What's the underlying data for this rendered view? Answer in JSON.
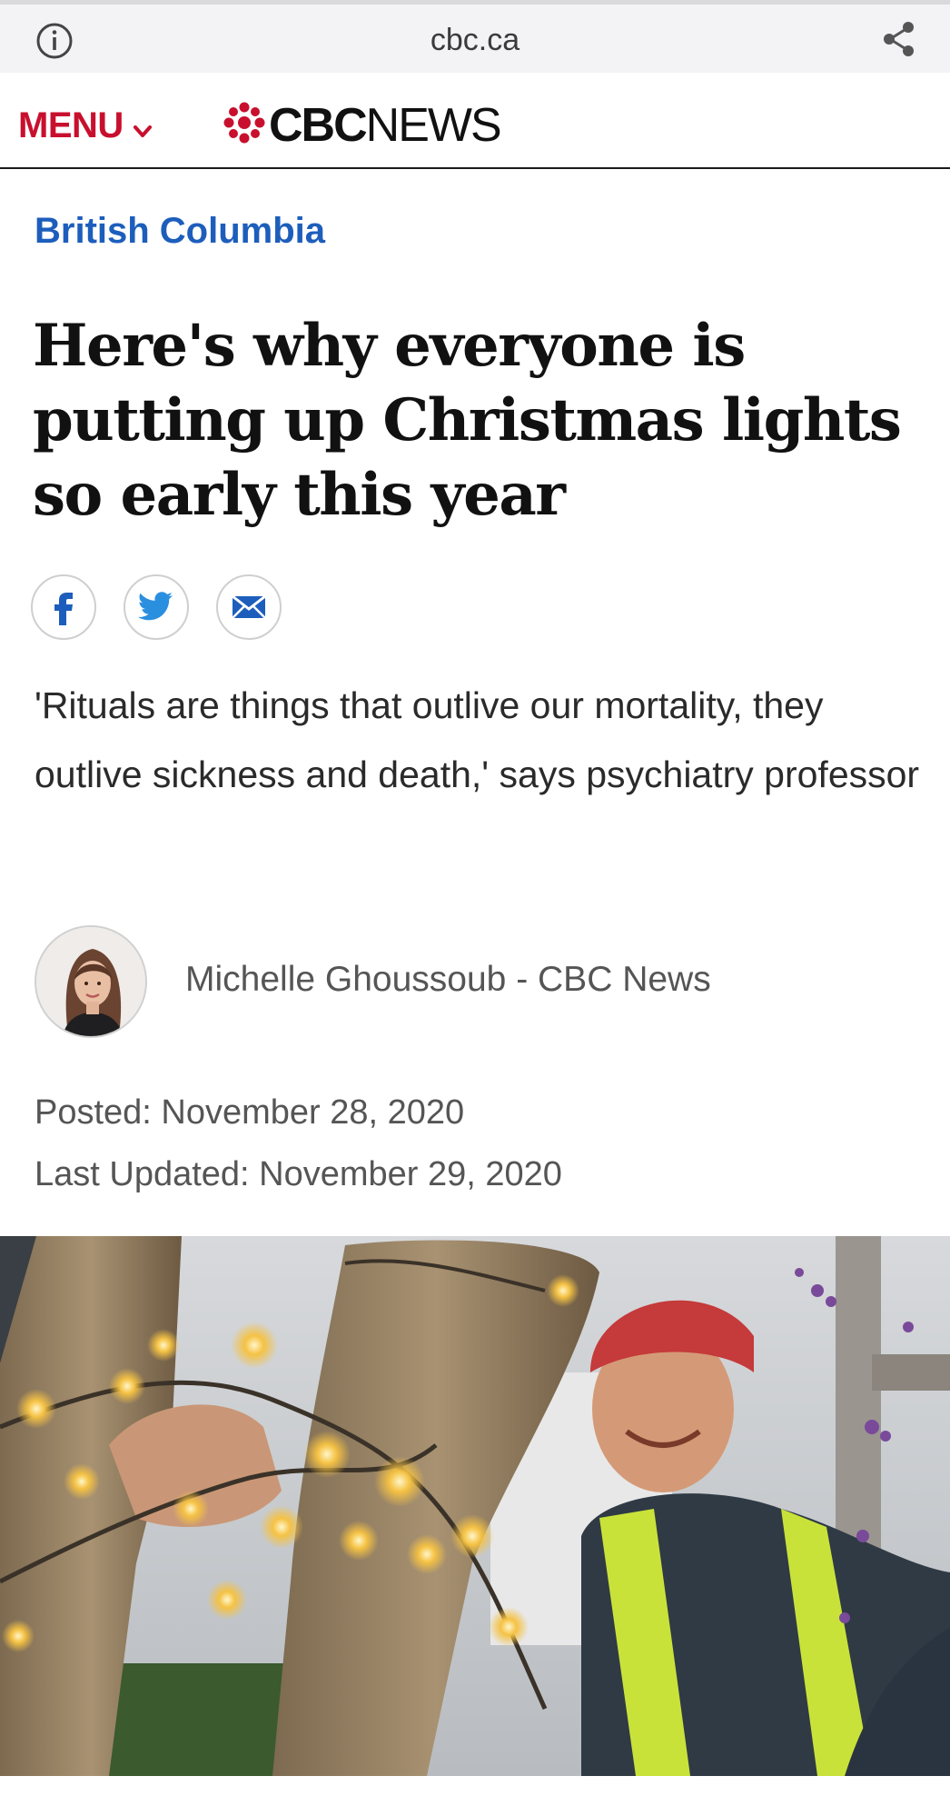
{
  "browser": {
    "domain": "cbc.ca",
    "info_icon": "info-icon",
    "share_icon": "share-icon"
  },
  "header": {
    "menu_label": "MENU",
    "logo_bold": "CBC",
    "logo_light": "NEWS",
    "brand_color": "#c8102e"
  },
  "article": {
    "section": "British Columbia",
    "section_color": "#1d5ebc",
    "headline": "Here's why everyone is putting up Christmas lights so early this year",
    "share_buttons": [
      "facebook-icon",
      "twitter-icon",
      "email-icon"
    ],
    "deck": "'Rituals are things that outlive our mortality, they outlive sickness and death,' says psychiatry professor",
    "author": "Michelle Ghoussoub - CBC News",
    "posted": "Posted: November 28, 2020",
    "updated": "Last Updated: November 29, 2020"
  }
}
